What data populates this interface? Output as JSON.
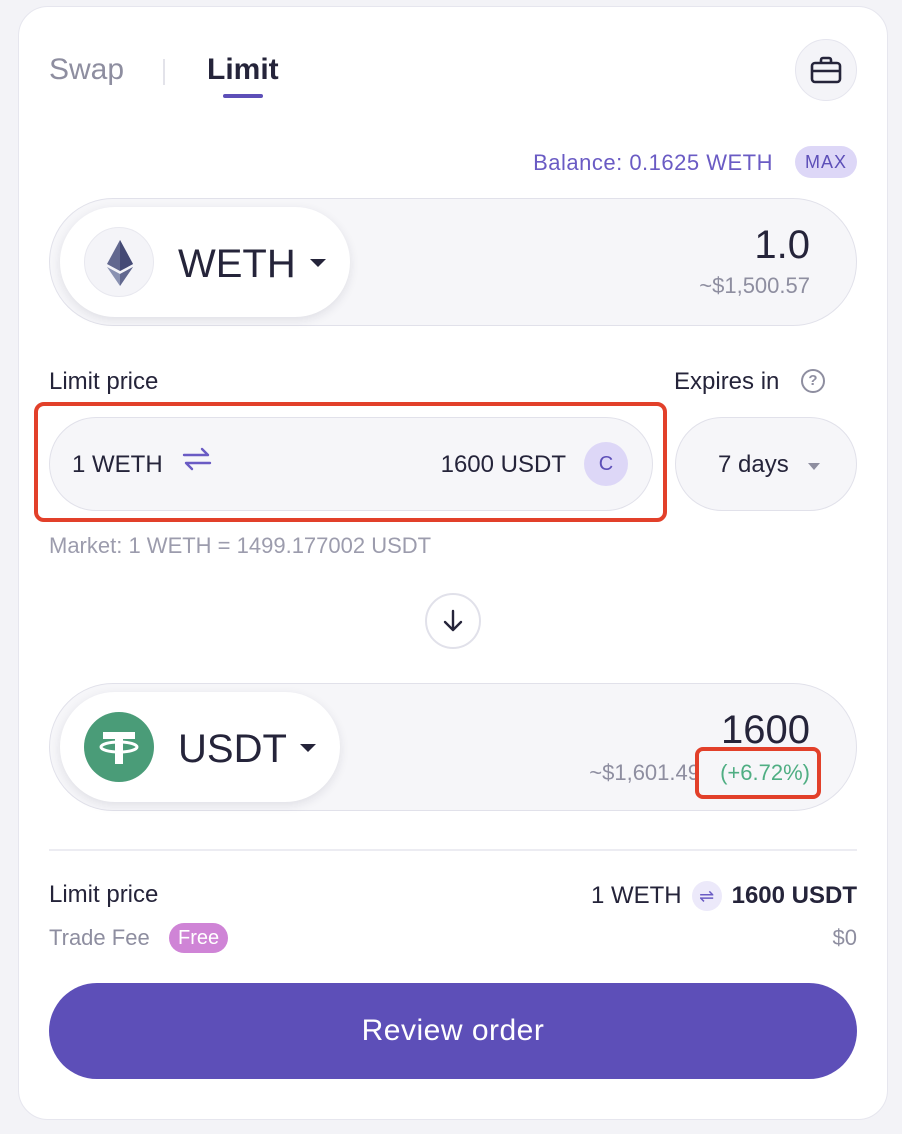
{
  "tabs": [
    {
      "label": "Swap",
      "active": false
    },
    {
      "label": "Limit",
      "active": true
    }
  ],
  "balance": {
    "text": "Balance: 0.1625 WETH",
    "max_label": "MAX"
  },
  "from_token": {
    "symbol": "WETH",
    "amount": "1.0",
    "usd": "~$1,500.57",
    "icon": "ethereum-icon"
  },
  "limit": {
    "label": "Limit price",
    "from": "1 WETH",
    "to": "1600 USDT",
    "refresh_label": "C",
    "market": "Market: 1 WETH = 1499.177002 USDT"
  },
  "expires": {
    "label": "Expires in",
    "help_label": "?",
    "value": "7 days"
  },
  "to_token": {
    "symbol": "USDT",
    "amount": "1600",
    "usd": "~$1,601.49",
    "change": "(+6.72%)",
    "icon": "tether-icon"
  },
  "summary": {
    "limit_label": "Limit price",
    "limit_from": "1 WETH",
    "limit_to": "1600 USDT",
    "fee_label": "Trade Fee",
    "fee_badge": "Free",
    "fee_value": "$0"
  },
  "review_button": "Review order",
  "colors": {
    "accent": "#5d4fb8",
    "positive": "#4fae83",
    "highlight": "#e2402a",
    "tether": "#4a9c78"
  }
}
